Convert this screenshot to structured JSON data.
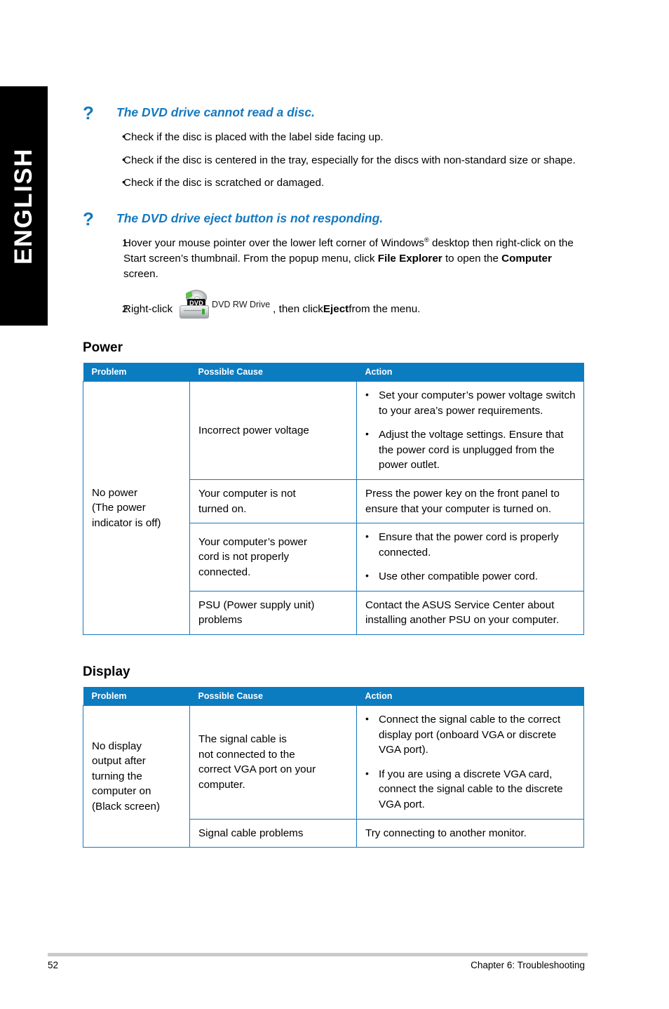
{
  "sidebar": {
    "language_label": "ENGLISH"
  },
  "faq": [
    {
      "marker": "?",
      "title": "The DVD drive cannot read a disc.",
      "list_type": "bullet",
      "items": [
        {
          "marker": "•",
          "text": "Check if the disc is placed with the label side facing up."
        },
        {
          "marker": "•",
          "text": "Check if the disc is centered in the tray, especially for the discs with non-standard size or shape."
        },
        {
          "marker": "•",
          "text": "Check if the disc is scratched or damaged."
        }
      ]
    },
    {
      "marker": "?",
      "title": "The DVD drive eject button is not responding.",
      "list_type": "number",
      "steps": {
        "step1": {
          "marker": "1.",
          "part1": "Hover your mouse pointer over the lower left corner of Windows",
          "sup": "®",
          "part2": " desktop then right-click on the Start screen’s thumbnail. From the popup menu, click ",
          "bold1": "File Explorer",
          "part3": " to open the ",
          "bold2": "Computer",
          "part4": " screen."
        },
        "step2": {
          "marker": "2.",
          "prefix": "Right-click",
          "icon_name": "dvd-rw-drive-icon",
          "icon_badge": "DVD",
          "icon_label": "DVD RW Drive",
          "middle": ", then click ",
          "bold": "Eject",
          "suffix": " from the menu."
        }
      }
    }
  ],
  "sections": [
    {
      "heading": "Power",
      "table": {
        "headers": [
          "Problem",
          "Possible Cause",
          "Action"
        ],
        "problem": "No power\n(The power\nindicator is off)",
        "problem_lines": [
          "No power",
          "(The power",
          "indicator is off)"
        ],
        "rows": [
          {
            "cause_lines": [
              "Incorrect power voltage"
            ],
            "action_type": "bullets",
            "action_bullets": [
              "Set your computer’s power voltage switch to your area’s power requirements.",
              "Adjust the voltage settings. Ensure that the power cord is unplugged from the power outlet."
            ]
          },
          {
            "cause_lines": [
              "Your computer is not",
              "turned on."
            ],
            "action_type": "text",
            "action_text": "Press the power key on the front panel to ensure that your computer is turned on."
          },
          {
            "cause_lines": [
              "Your computer’s power",
              "cord is not properly",
              "connected."
            ],
            "action_type": "bullets",
            "action_bullets": [
              "Ensure that the power cord is properly connected.",
              "Use other compatible power cord."
            ]
          },
          {
            "cause_lines": [
              "PSU (Power supply unit)",
              "problems"
            ],
            "action_type": "text",
            "action_text": "Contact the ASUS Service Center about installing another PSU on your computer."
          }
        ]
      }
    },
    {
      "heading": "Display",
      "table": {
        "headers": [
          "Problem",
          "Possible Cause",
          "Action"
        ],
        "problem_lines": [
          "No display",
          "output after",
          "turning the",
          "computer on",
          "(Black screen)"
        ],
        "rows": [
          {
            "cause_lines": [
              "The signal cable is",
              "not connected to the",
              "correct VGA port on your",
              "computer."
            ],
            "action_type": "bullets",
            "action_bullets": [
              "Connect the signal cable to the correct display port (onboard VGA or discrete VGA port).",
              "If you are using a discrete VGA card, connect the signal cable to the discrete VGA port."
            ]
          },
          {
            "cause_lines": [
              "Signal cable problems"
            ],
            "action_type": "text",
            "action_text": "Try connecting to another monitor."
          }
        ]
      }
    }
  ],
  "footer": {
    "page_number": "52",
    "chapter": "Chapter 6: Troubleshooting"
  },
  "colors": {
    "accent_blue": "#1379C0",
    "header_blue": "#0C7CC1",
    "sidebar_black": "#000000",
    "footer_rule": "#c8cacc"
  }
}
